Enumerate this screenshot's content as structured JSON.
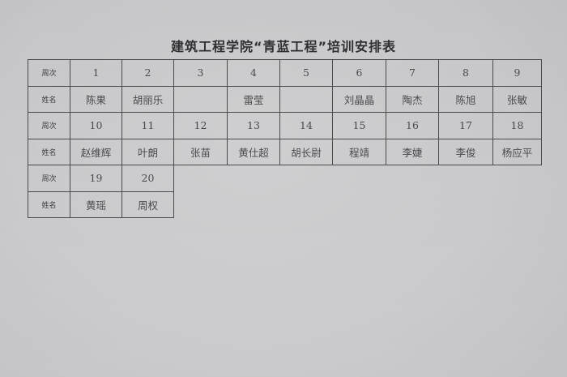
{
  "title": "建筑工程学院“青蓝工程”培训安排表",
  "labels": {
    "week": "周次",
    "name": "姓名"
  },
  "rows": [
    {
      "weeks": [
        "1",
        "2",
        "3",
        "4",
        "5",
        "6",
        "7",
        "8",
        "9"
      ],
      "names": [
        "陈果",
        "胡丽乐",
        "",
        "雷莹",
        "",
        "刘晶晶",
        "陶杰",
        "陈旭",
        "张敏"
      ]
    },
    {
      "weeks": [
        "10",
        "11",
        "12",
        "13",
        "14",
        "15",
        "16",
        "17",
        "18"
      ],
      "names": [
        "赵维辉",
        "叶朗",
        "张苗",
        "黄仕超",
        "胡长尉",
        "程靖",
        "李婕",
        "李俊",
        "杨应平"
      ]
    },
    {
      "weeks": [
        "19",
        "20"
      ],
      "names": [
        "黄瑶",
        "周权"
      ]
    }
  ]
}
